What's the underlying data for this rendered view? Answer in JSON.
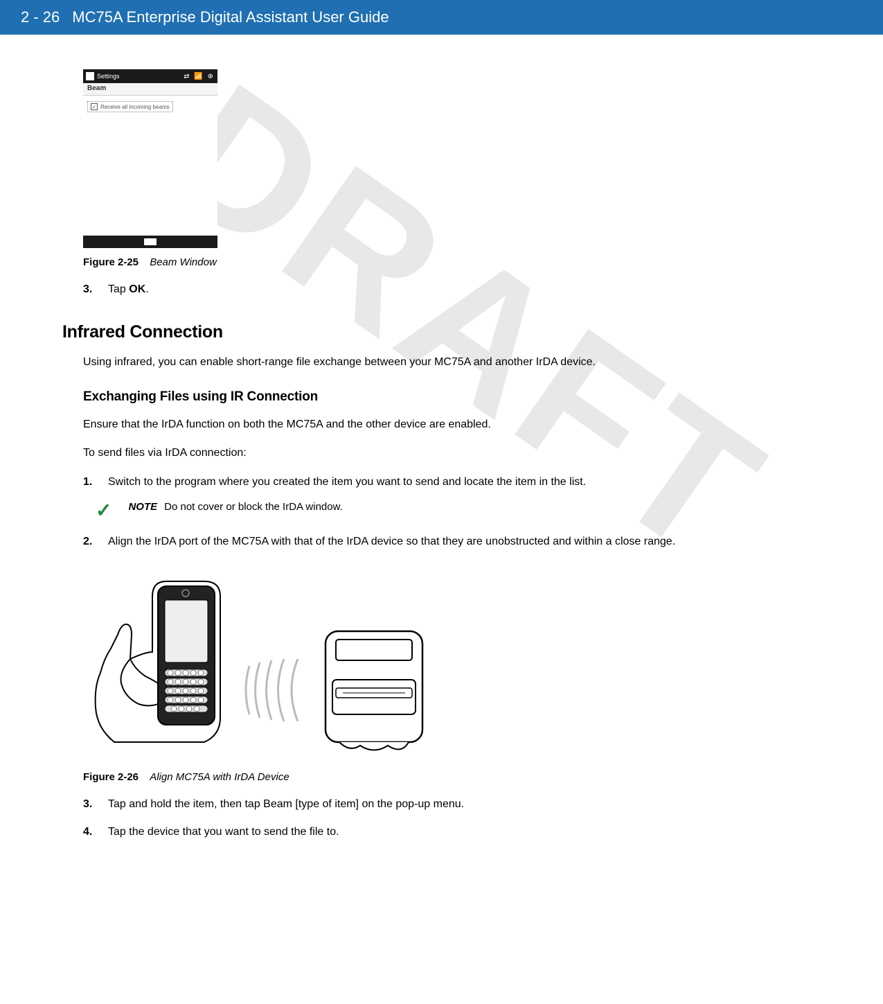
{
  "header": {
    "page_number": "2 - 26",
    "doc_title": "MC75A Enterprise Digital Assistant User Guide"
  },
  "watermark": "DRAFT",
  "screenshot": {
    "topbar_label": "Settings",
    "title": "Beam",
    "checkbox_label": "Receive all incoming beams"
  },
  "figure25": {
    "label": "Figure 2-25",
    "title": "Beam Window"
  },
  "step3a": {
    "num": "3.",
    "text_pre": "Tap ",
    "text_bold": "OK",
    "text_post": "."
  },
  "section_infrared": "Infrared Connection",
  "infrared_para": "Using infrared, you can enable short-range file exchange between your MC75A and another IrDA device.",
  "subsection_exchange": "Exchanging Files using IR Connection",
  "exchange_para1": "Ensure that the IrDA function on both the MC75A and the other device are enabled.",
  "exchange_para2": "To send files via IrDA connection:",
  "step1": {
    "num": "1.",
    "text": "Switch to the program where you created the item you want to send and locate the item in the list."
  },
  "note": {
    "label": "NOTE",
    "text": "Do not cover or block the IrDA window."
  },
  "step2": {
    "num": "2.",
    "text": "Align the IrDA port of the MC75A with that of the IrDA device so that they are unobstructed and within a close range."
  },
  "figure26": {
    "label": "Figure 2-26",
    "title": "Align MC75A with IrDA Device"
  },
  "step3b": {
    "num": "3.",
    "text": "Tap and hold the item, then tap Beam [type of item] on the pop-up menu."
  },
  "step4": {
    "num": "4.",
    "text": "Tap the device that you want to send the file to."
  }
}
